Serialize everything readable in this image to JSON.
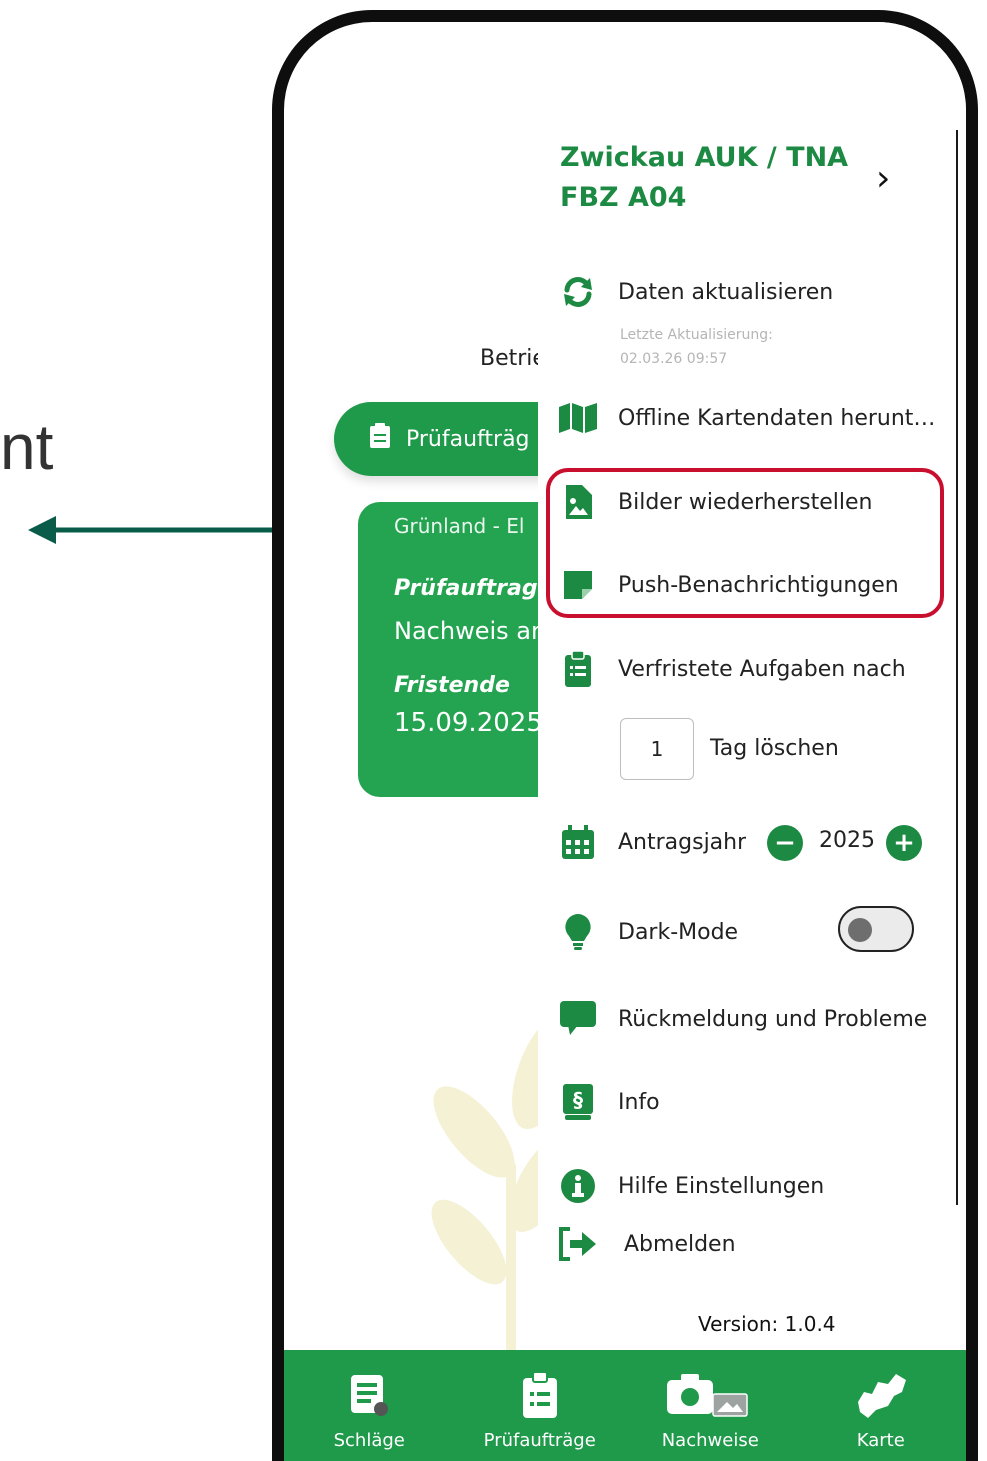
{
  "annotation": {
    "partial_text": "nt",
    "arrow_color": "#0a5c4a"
  },
  "background_app": {
    "label": "Betrie",
    "tab_label": "Prüfaufträg",
    "card": {
      "line1": "Grünland - El",
      "line2": "Prüfauftrag",
      "line3": "Nachweis ar",
      "line4": "Fristende",
      "line5": "15.09.2025"
    }
  },
  "menu": {
    "header_line1": "Zwickau AUK / TNA",
    "header_line2": "FBZ A04",
    "header_chevron": "›",
    "items": {
      "refresh": {
        "label": "Daten aktualisieren",
        "icon": "sync-icon"
      },
      "last_update_label": "Letzte Aktualisierung:",
      "last_update_time": "02.03.26 09:57",
      "offline_maps": {
        "label": "Offline Kartendaten herunte...",
        "icon": "map-icon"
      },
      "restore_images": {
        "label": "Bilder wiederherstellen",
        "icon": "image-file-icon"
      },
      "push": {
        "label": "Push-Benachrichtigungen",
        "icon": "note-icon"
      },
      "expired": {
        "label": "Verfristete Aufgaben nach",
        "icon": "clipboard-list-icon"
      },
      "days_value": "1",
      "days_label": "Tag löschen",
      "year": {
        "label": "Antragsjahr",
        "value": "2025",
        "minus": "−",
        "plus": "+",
        "icon": "calendar-icon"
      },
      "dark_mode": {
        "label": "Dark-Mode",
        "icon": "lightbulb-icon",
        "enabled": false
      },
      "feedback": {
        "label": "Rückmeldung und Probleme",
        "icon": "comment-icon"
      },
      "info": {
        "label": "Info",
        "icon": "paragraph-book-icon"
      },
      "help": {
        "label": "Hilfe Einstellungen",
        "icon": "info-circle-icon"
      },
      "logout": {
        "label": "Abmelden",
        "icon": "sign-out-icon"
      }
    },
    "version": "Version: 1.0.4"
  },
  "bottom_nav": [
    {
      "label": "Schläge",
      "icon": "fields-list-icon"
    },
    {
      "label": "Prüfaufträge",
      "icon": "clipboard-icon"
    },
    {
      "label": "Nachweise",
      "icon": "camera-icon"
    },
    {
      "label": "Karte",
      "icon": "saxony-map-icon"
    }
  ],
  "colors": {
    "brand_green": "#1f9a4a",
    "header_green": "#1d8a43",
    "highlight_red": "#c8102e"
  }
}
